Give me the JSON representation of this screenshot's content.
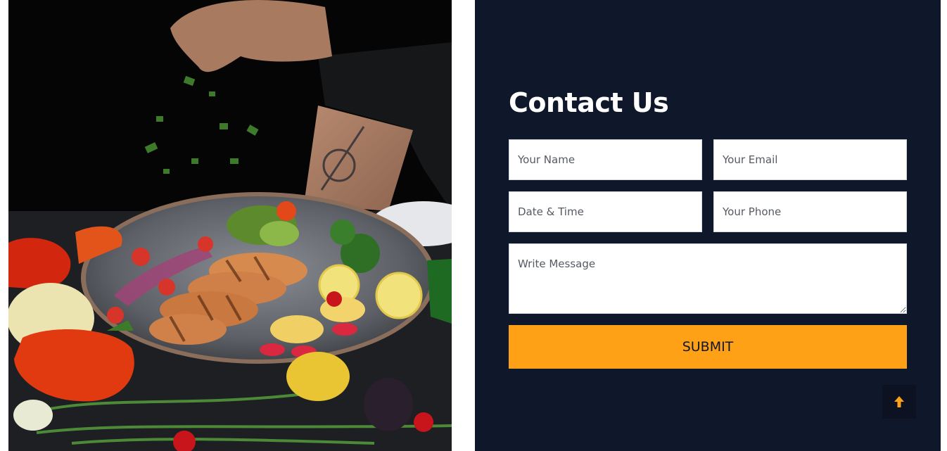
{
  "hero_image": {
    "description": "chef-sprinkling-herbs-over-grilled-chicken-plate",
    "colors": {
      "background": "#050505",
      "plate": "#5d6066",
      "accent_pepper": "#e13a10"
    }
  },
  "contact": {
    "title": "Contact Us",
    "fields": {
      "name": {
        "placeholder": "Your Name",
        "value": ""
      },
      "email": {
        "placeholder": "Your Email",
        "value": ""
      },
      "datetime": {
        "placeholder": "Date & Time",
        "value": ""
      },
      "phone": {
        "placeholder": "Your Phone",
        "value": ""
      },
      "message": {
        "placeholder": "Write Message",
        "value": ""
      }
    },
    "submit_label": "SUBMIT",
    "scroll_top_icon": "arrow-up-icon"
  },
  "colors": {
    "panel_bg": "#0f172b",
    "accent": "#fea116",
    "field_bg": "#ffffff",
    "title_text": "#ffffff"
  }
}
